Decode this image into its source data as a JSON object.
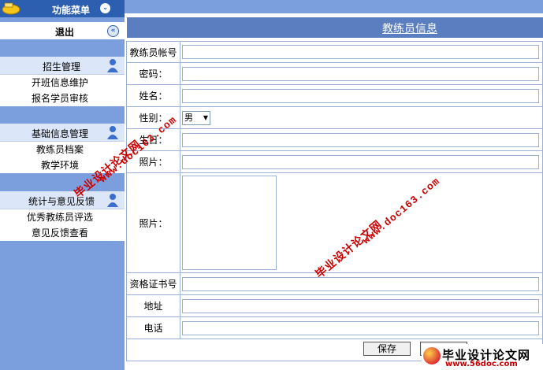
{
  "sidebar": {
    "menu_title": "功能菜单",
    "logout_label": "退出",
    "groups": [
      {
        "title": "招生管理",
        "items": [
          "开班信息维护",
          "报名学员审核"
        ]
      },
      {
        "title": "基础信息管理",
        "items": [
          "教练员档案",
          "教学环境"
        ]
      },
      {
        "title": "统计与意见反馈",
        "items": [
          "优秀教练员评选",
          "意见反馈查看"
        ]
      }
    ]
  },
  "page": {
    "title": "教练员信息"
  },
  "form": {
    "fields": {
      "account": "教练员帐号",
      "password": "密码：",
      "name": "姓名：",
      "gender": "性别：",
      "birthday": "生日：",
      "photo_upload": "照片：",
      "photo": "照片：",
      "cert": "资格证书号",
      "address": "地址",
      "phone": "电话"
    },
    "gender_value": "男"
  },
  "buttons": {
    "save": "保存",
    "reset": "返回"
  },
  "watermarks": {
    "cn": "毕业设计论文网",
    "url": "www.doc163.com"
  },
  "footer_brand": {
    "name": "毕业设计论文网",
    "url": "www.56doc.com"
  },
  "icons": {
    "menu_logo": "folder-icon",
    "collapse": "chevron-down-icon",
    "back": "double-chevron-left-icon",
    "group": "person-icon"
  },
  "colors": {
    "sidebar": "#7b9edd",
    "menu_head": "#2d5fb0",
    "title_bar": "#5b7ec1",
    "watermark": "#cc0000"
  }
}
